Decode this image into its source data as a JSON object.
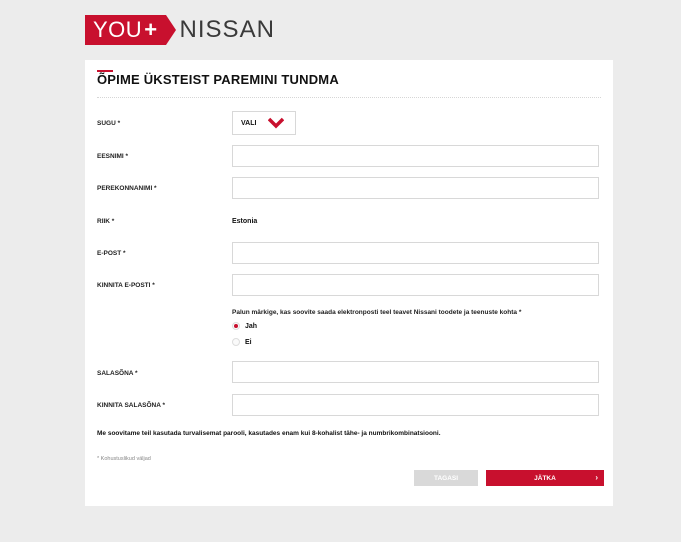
{
  "logo": {
    "you": "YOU",
    "plus": "+",
    "brand": "NISSAN"
  },
  "form": {
    "title": "ÕPIME ÜKSTEIST PAREMINI TUNDMA",
    "fields": {
      "gender": {
        "label": "SUGU *",
        "value": "VALI"
      },
      "first_name": {
        "label": "EESNIMI *",
        "value": ""
      },
      "last_name": {
        "label": "PEREKONNANIMI *",
        "value": ""
      },
      "country": {
        "label": "RIIK *",
        "value": "Estonia"
      },
      "email": {
        "label": "E-POST *",
        "value": ""
      },
      "email_confirm": {
        "label": "KINNITA E-POSTI *",
        "value": ""
      },
      "password": {
        "label": "SALASÕNA *",
        "value": ""
      },
      "password_confirm": {
        "label": "KINNITA SALASÕNA *",
        "value": ""
      }
    },
    "consent": {
      "question": "Palun märkige, kas soovite saada elektronposti teel teavet Nissani toodete ja teenuste kohta *",
      "options": [
        {
          "label": "Jah",
          "selected": true
        },
        {
          "label": "Ei",
          "selected": false
        }
      ]
    },
    "password_hint": "Me soovitame teil kasutada turvalisemat parooli, kasutades enam kui 8-kohalist tähe- ja numbrikombinatsiooni.",
    "required_note": "* Kohustuslikud väljad",
    "buttons": {
      "back": "TAGASI",
      "next": "JÄTKA",
      "next_chevron": "›"
    }
  },
  "colors": {
    "accent": "#c8102e",
    "background": "#ececec"
  },
  "icons": {
    "select_arrow": "chevron-down-icon"
  }
}
